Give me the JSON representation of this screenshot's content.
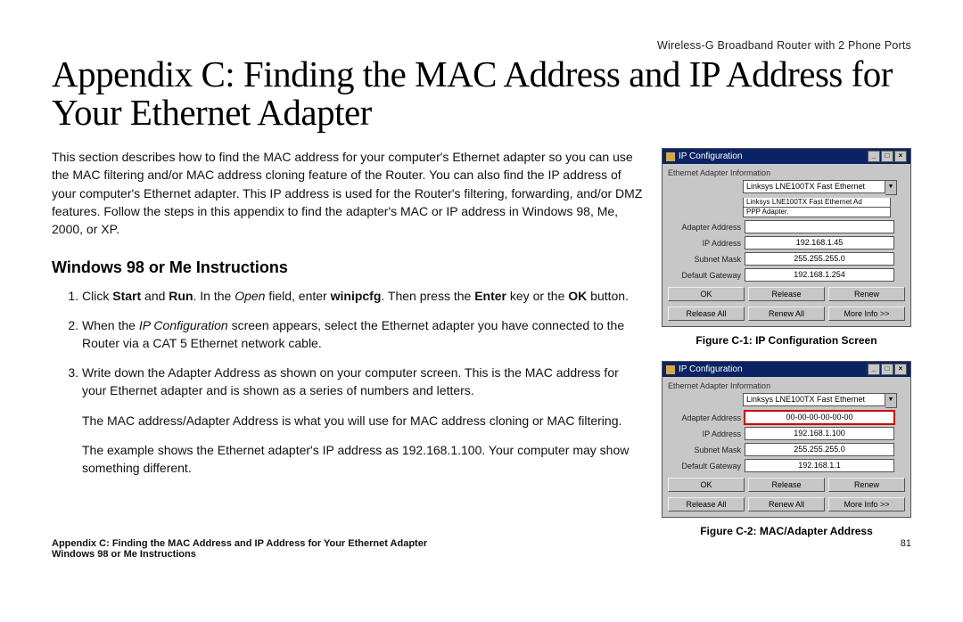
{
  "header_label": "Wireless-G Broadband Router with 2 Phone Ports",
  "title": "Appendix C: Finding the MAC Address and IP Address for Your Ethernet Adapter",
  "intro": "This section describes how to find the MAC address for your computer's Ethernet adapter so you can use the MAC filtering and/or MAC address cloning feature of the Router. You can also find the IP address of your computer's Ethernet adapter. This IP address is used for the Router's filtering, forwarding, and/or DMZ features. Follow the steps in this appendix to find the adapter's MAC or IP address in Windows 98, Me, 2000, or XP.",
  "subhead": "Windows 98 or Me Instructions",
  "steps": {
    "s1_a": "Click ",
    "s1_b": "Start",
    "s1_c": " and ",
    "s1_d": "Run",
    "s1_e": ". In the ",
    "s1_f": "Open",
    "s1_g": " field, enter ",
    "s1_h": "winipcfg",
    "s1_i": ". Then press the ",
    "s1_j": "Enter",
    "s1_k": " key or the ",
    "s1_l": "OK",
    "s1_m": " button.",
    "s2_a": "When the ",
    "s2_b": "IP Configuration",
    "s2_c": " screen appears, select the Ethernet adapter you have connected to the Router via a CAT 5 Ethernet network cable.",
    "s3": "Write down the Adapter Address as shown on your computer screen. This is the MAC address for your Ethernet adapter and is shown as a series of numbers and letters.",
    "s3_p2": "The MAC address/Adapter Address is what you will use for MAC address cloning or MAC filtering.",
    "s3_p3": "The example shows the Ethernet adapter's IP address as 192.168.1.100. Your computer may show something different."
  },
  "fig1": {
    "win_title": "IP Configuration",
    "section": "Ethernet Adapter Information",
    "combo_sel": "Linksys LNE100TX Fast Ethernet",
    "combo_extra": "Linksys LNE100TX Fast Ethernet Ad",
    "adapter_label": "Adapter Address",
    "adapter_val": "",
    "ip_label": "IP Address",
    "ip_val": "192.168.1.45",
    "subnet_label": "Subnet Mask",
    "subnet_val": "255.255.255.0",
    "gw_label": "Default Gateway",
    "gw_val": "192.168.1.254",
    "btn_ok": "OK",
    "btn_release": "Release",
    "btn_renew": "Renew",
    "btn_releaseall": "Release All",
    "btn_renewall": "Renew All",
    "btn_more": "More Info >>",
    "caption": "Figure C-1: IP Configuration Screen",
    "extra_line": "PPP Adapter."
  },
  "fig2": {
    "win_title": "IP Configuration",
    "section": "Ethernet Adapter Information",
    "combo_sel": "Linksys LNE100TX Fast Ethernet",
    "adapter_label": "Adapter Address",
    "adapter_val": "00-00-00-00-00-00",
    "ip_label": "IP Address",
    "ip_val": "192.168.1.100",
    "subnet_label": "Subnet Mask",
    "subnet_val": "255.255.255.0",
    "gw_label": "Default Gateway",
    "gw_val": "192.168.1.1",
    "btn_ok": "OK",
    "btn_release": "Release",
    "btn_renew": "Renew",
    "btn_releaseall": "Release All",
    "btn_renewall": "Renew All",
    "btn_more": "More Info >>",
    "caption": "Figure C-2: MAC/Adapter Address"
  },
  "footer": {
    "line1": "Appendix C: Finding the MAC Address and IP Address for Your Ethernet Adapter",
    "line2": "Windows 98 or Me Instructions",
    "page": "81"
  }
}
